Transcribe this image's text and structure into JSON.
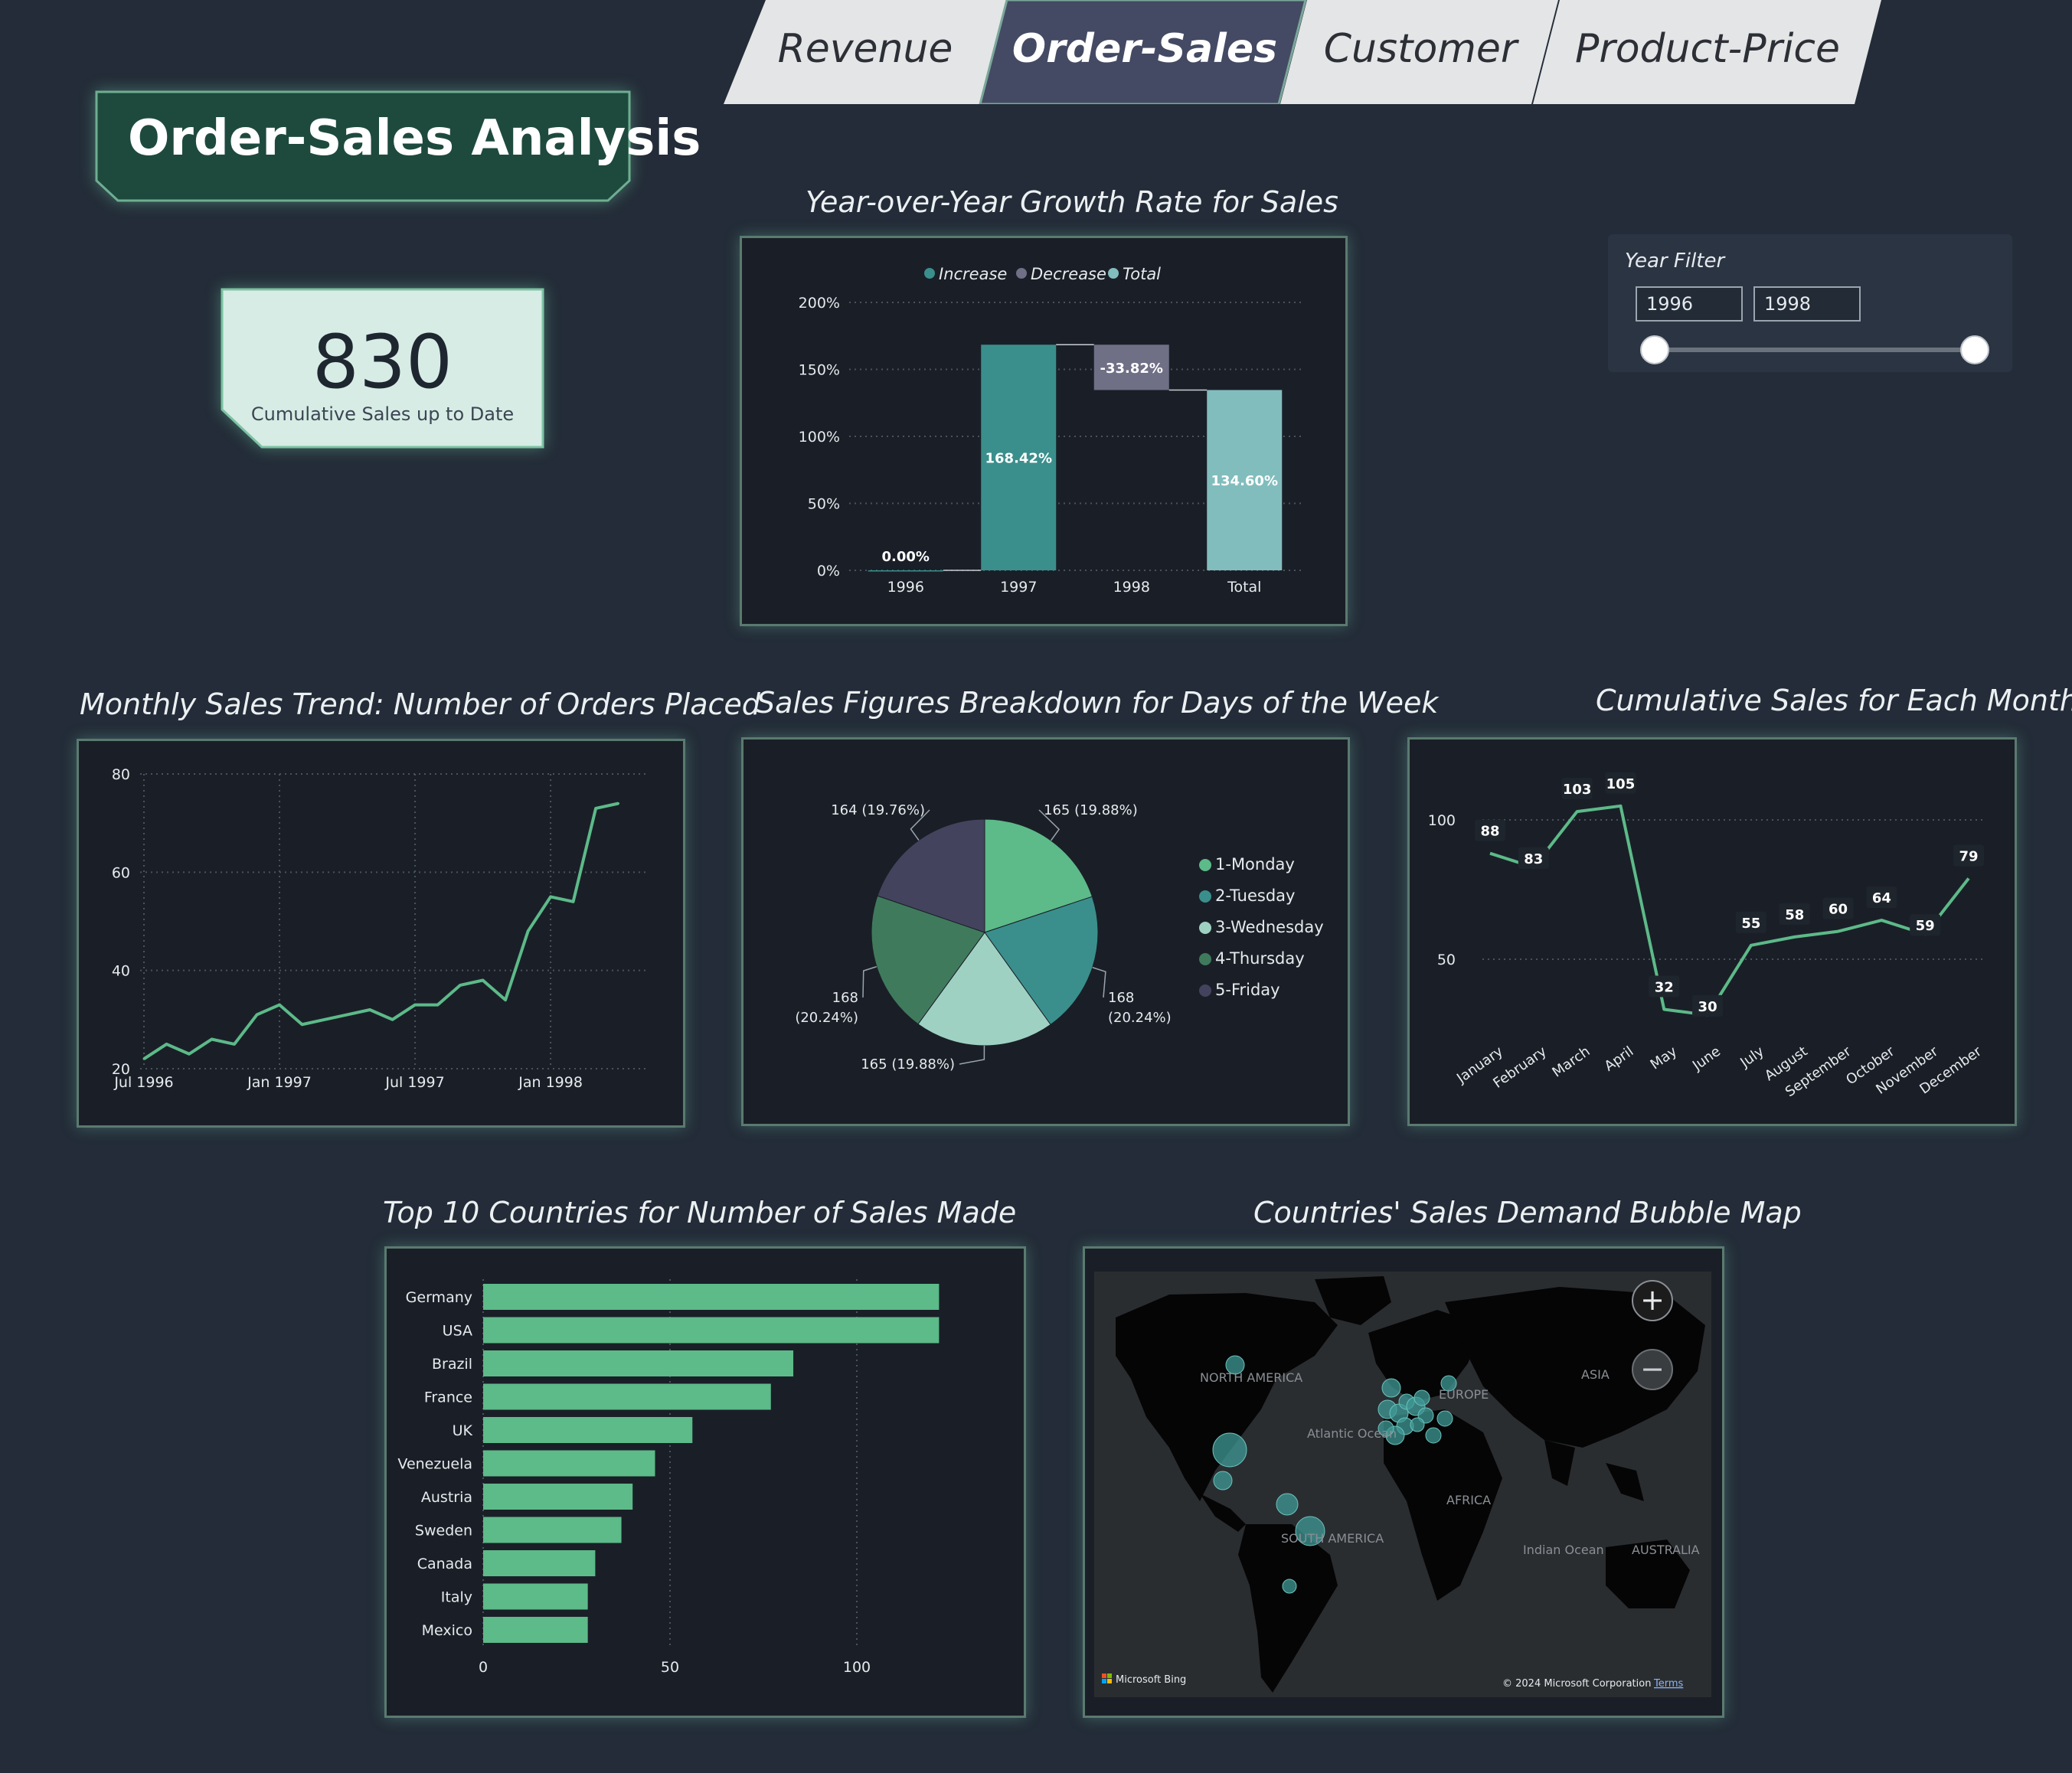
{
  "tabs": [
    {
      "label": "Revenue",
      "active": false
    },
    {
      "label": "Order-Sales",
      "active": true
    },
    {
      "label": "Customer",
      "active": false
    },
    {
      "label": "Product-Price",
      "active": false
    }
  ],
  "page_title": "Order-Sales Analysis",
  "kpi": {
    "value": "830",
    "label": "Cumulative Sales up to Date"
  },
  "year_filter": {
    "title": "Year Filter",
    "start": "1996",
    "end": "1998"
  },
  "colors": {
    "accent": "#5dba89",
    "teal": "#3a8f8c",
    "light_teal": "#82bdbd",
    "decrease": "#6f6f86",
    "panel_bg": "#1a1f27",
    "page_bg": "#232c38"
  },
  "visuals": {
    "yoy": {
      "title": "Year-over-Year Growth Rate for Sales"
    },
    "monthly": {
      "title": "Monthly Sales Trend: Number of Orders Placed"
    },
    "weekday": {
      "title": "Sales Figures Breakdown for Days of the Week"
    },
    "cumulative": {
      "title": "Cumulative Sales for Each Month"
    },
    "countries": {
      "title": "Top 10 Countries for Number of Sales Made"
    },
    "map": {
      "title": "Countries' Sales Demand Bubble Map"
    }
  },
  "chart_data": [
    {
      "id": "yoy",
      "type": "waterfall",
      "legend": [
        "Increase",
        "Decrease",
        "Total"
      ],
      "categories": [
        "1996",
        "1997",
        "1998",
        "Total"
      ],
      "values": [
        0.0,
        168.42,
        -33.82,
        134.6
      ],
      "value_labels": [
        "0.00%",
        "168.42%",
        "-33.82%",
        "134.60%"
      ],
      "kinds": [
        "increase",
        "increase",
        "decrease",
        "total"
      ],
      "yticks": [
        "0%",
        "50%",
        "100%",
        "150%",
        "200%"
      ],
      "ylim": [
        0,
        200
      ]
    },
    {
      "id": "monthly",
      "type": "line",
      "x": [
        "1996-07",
        "1996-08",
        "1996-09",
        "1996-10",
        "1996-11",
        "1996-12",
        "1997-01",
        "1997-02",
        "1997-03",
        "1997-04",
        "1997-05",
        "1997-06",
        "1997-07",
        "1997-08",
        "1997-09",
        "1997-10",
        "1997-11",
        "1997-12",
        "1998-01",
        "1998-02",
        "1998-03",
        "1998-04",
        "1998-05"
      ],
      "values": [
        22,
        25,
        23,
        26,
        25,
        31,
        33,
        29,
        30,
        31,
        32,
        30,
        33,
        33,
        37,
        38,
        34,
        48,
        55,
        54,
        73,
        74
      ],
      "xticks": [
        "Jul 1996",
        "Jan 1997",
        "Jul 1997",
        "Jan 1998"
      ],
      "yticks": [
        20,
        40,
        60,
        80
      ],
      "ylim": [
        20,
        80
      ]
    },
    {
      "id": "weekday",
      "type": "pie",
      "labels": [
        "1-Monday",
        "2-Tuesday",
        "3-Wednesday",
        "4-Thursday",
        "5-Friday"
      ],
      "values": [
        165,
        168,
        165,
        168,
        164
      ],
      "data_labels": [
        "165 (19.88%)",
        "168 (20.24%)",
        "165 (19.88%)",
        "168 (20.24%)",
        "164 (19.76%)"
      ],
      "colors": [
        "#5dba89",
        "#3a8f8c",
        "#9fd1c3",
        "#3f7a5c",
        "#44435e"
      ]
    },
    {
      "id": "cumulative",
      "type": "line",
      "categories": [
        "January",
        "February",
        "March",
        "April",
        "May",
        "June",
        "July",
        "August",
        "September",
        "October",
        "November",
        "December"
      ],
      "values": [
        88,
        83,
        103,
        105,
        32,
        30,
        55,
        58,
        60,
        64,
        59,
        79
      ],
      "yticks": [
        50,
        100
      ]
    },
    {
      "id": "countries",
      "type": "bar",
      "categories": [
        "Germany",
        "USA",
        "Brazil",
        "France",
        "UK",
        "Venezuela",
        "Austria",
        "Sweden",
        "Canada",
        "Italy",
        "Mexico"
      ],
      "values": [
        122,
        122,
        83,
        77,
        56,
        46,
        40,
        37,
        30,
        28,
        28
      ],
      "xticks": [
        0,
        50,
        100
      ]
    }
  ],
  "map": {
    "labels": [
      "NORTH AMERICA",
      "EUROPE",
      "ASIA",
      "Atlantic Ocean",
      "AFRICA",
      "SOUTH AMERICA",
      "Indian Ocean",
      "AUSTRALIA"
    ],
    "attribution_left": "Microsoft Bing",
    "attribution_right": "© 2024 Microsoft Corporation",
    "terms": "Terms",
    "zoom_in": "+",
    "zoom_out": "−"
  }
}
